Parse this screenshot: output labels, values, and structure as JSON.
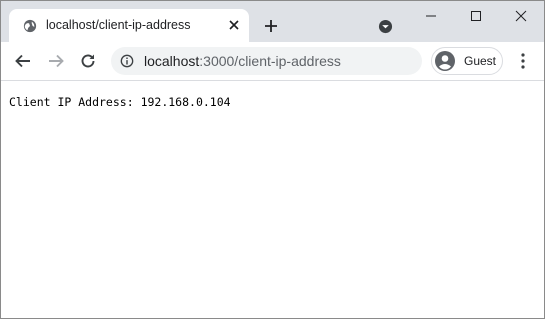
{
  "tab": {
    "title": "localhost/client-ip-address"
  },
  "omnibox": {
    "host": "localhost",
    "path": ":3000/client-ip-address"
  },
  "profile": {
    "label": "Guest"
  },
  "page": {
    "label": "Client IP Address:",
    "value": "192.168.0.104"
  },
  "icons": {
    "favicon": "globe-icon",
    "tab_close": "close-icon",
    "new_tab": "plus-icon",
    "tab_search": "chevron-down-circle-icon",
    "minimize": "minimize-icon",
    "maximize": "maximize-icon",
    "close_window": "close-icon",
    "back": "back-arrow-icon",
    "forward": "forward-arrow-icon",
    "reload": "reload-icon",
    "site_info": "info-icon",
    "avatar": "person-icon",
    "menu": "kebab-menu-icon"
  },
  "colors": {
    "tabstrip": "#dee1e6",
    "omnibox": "#f1f3f4",
    "text": "#202124",
    "muted": "#5f6368"
  }
}
